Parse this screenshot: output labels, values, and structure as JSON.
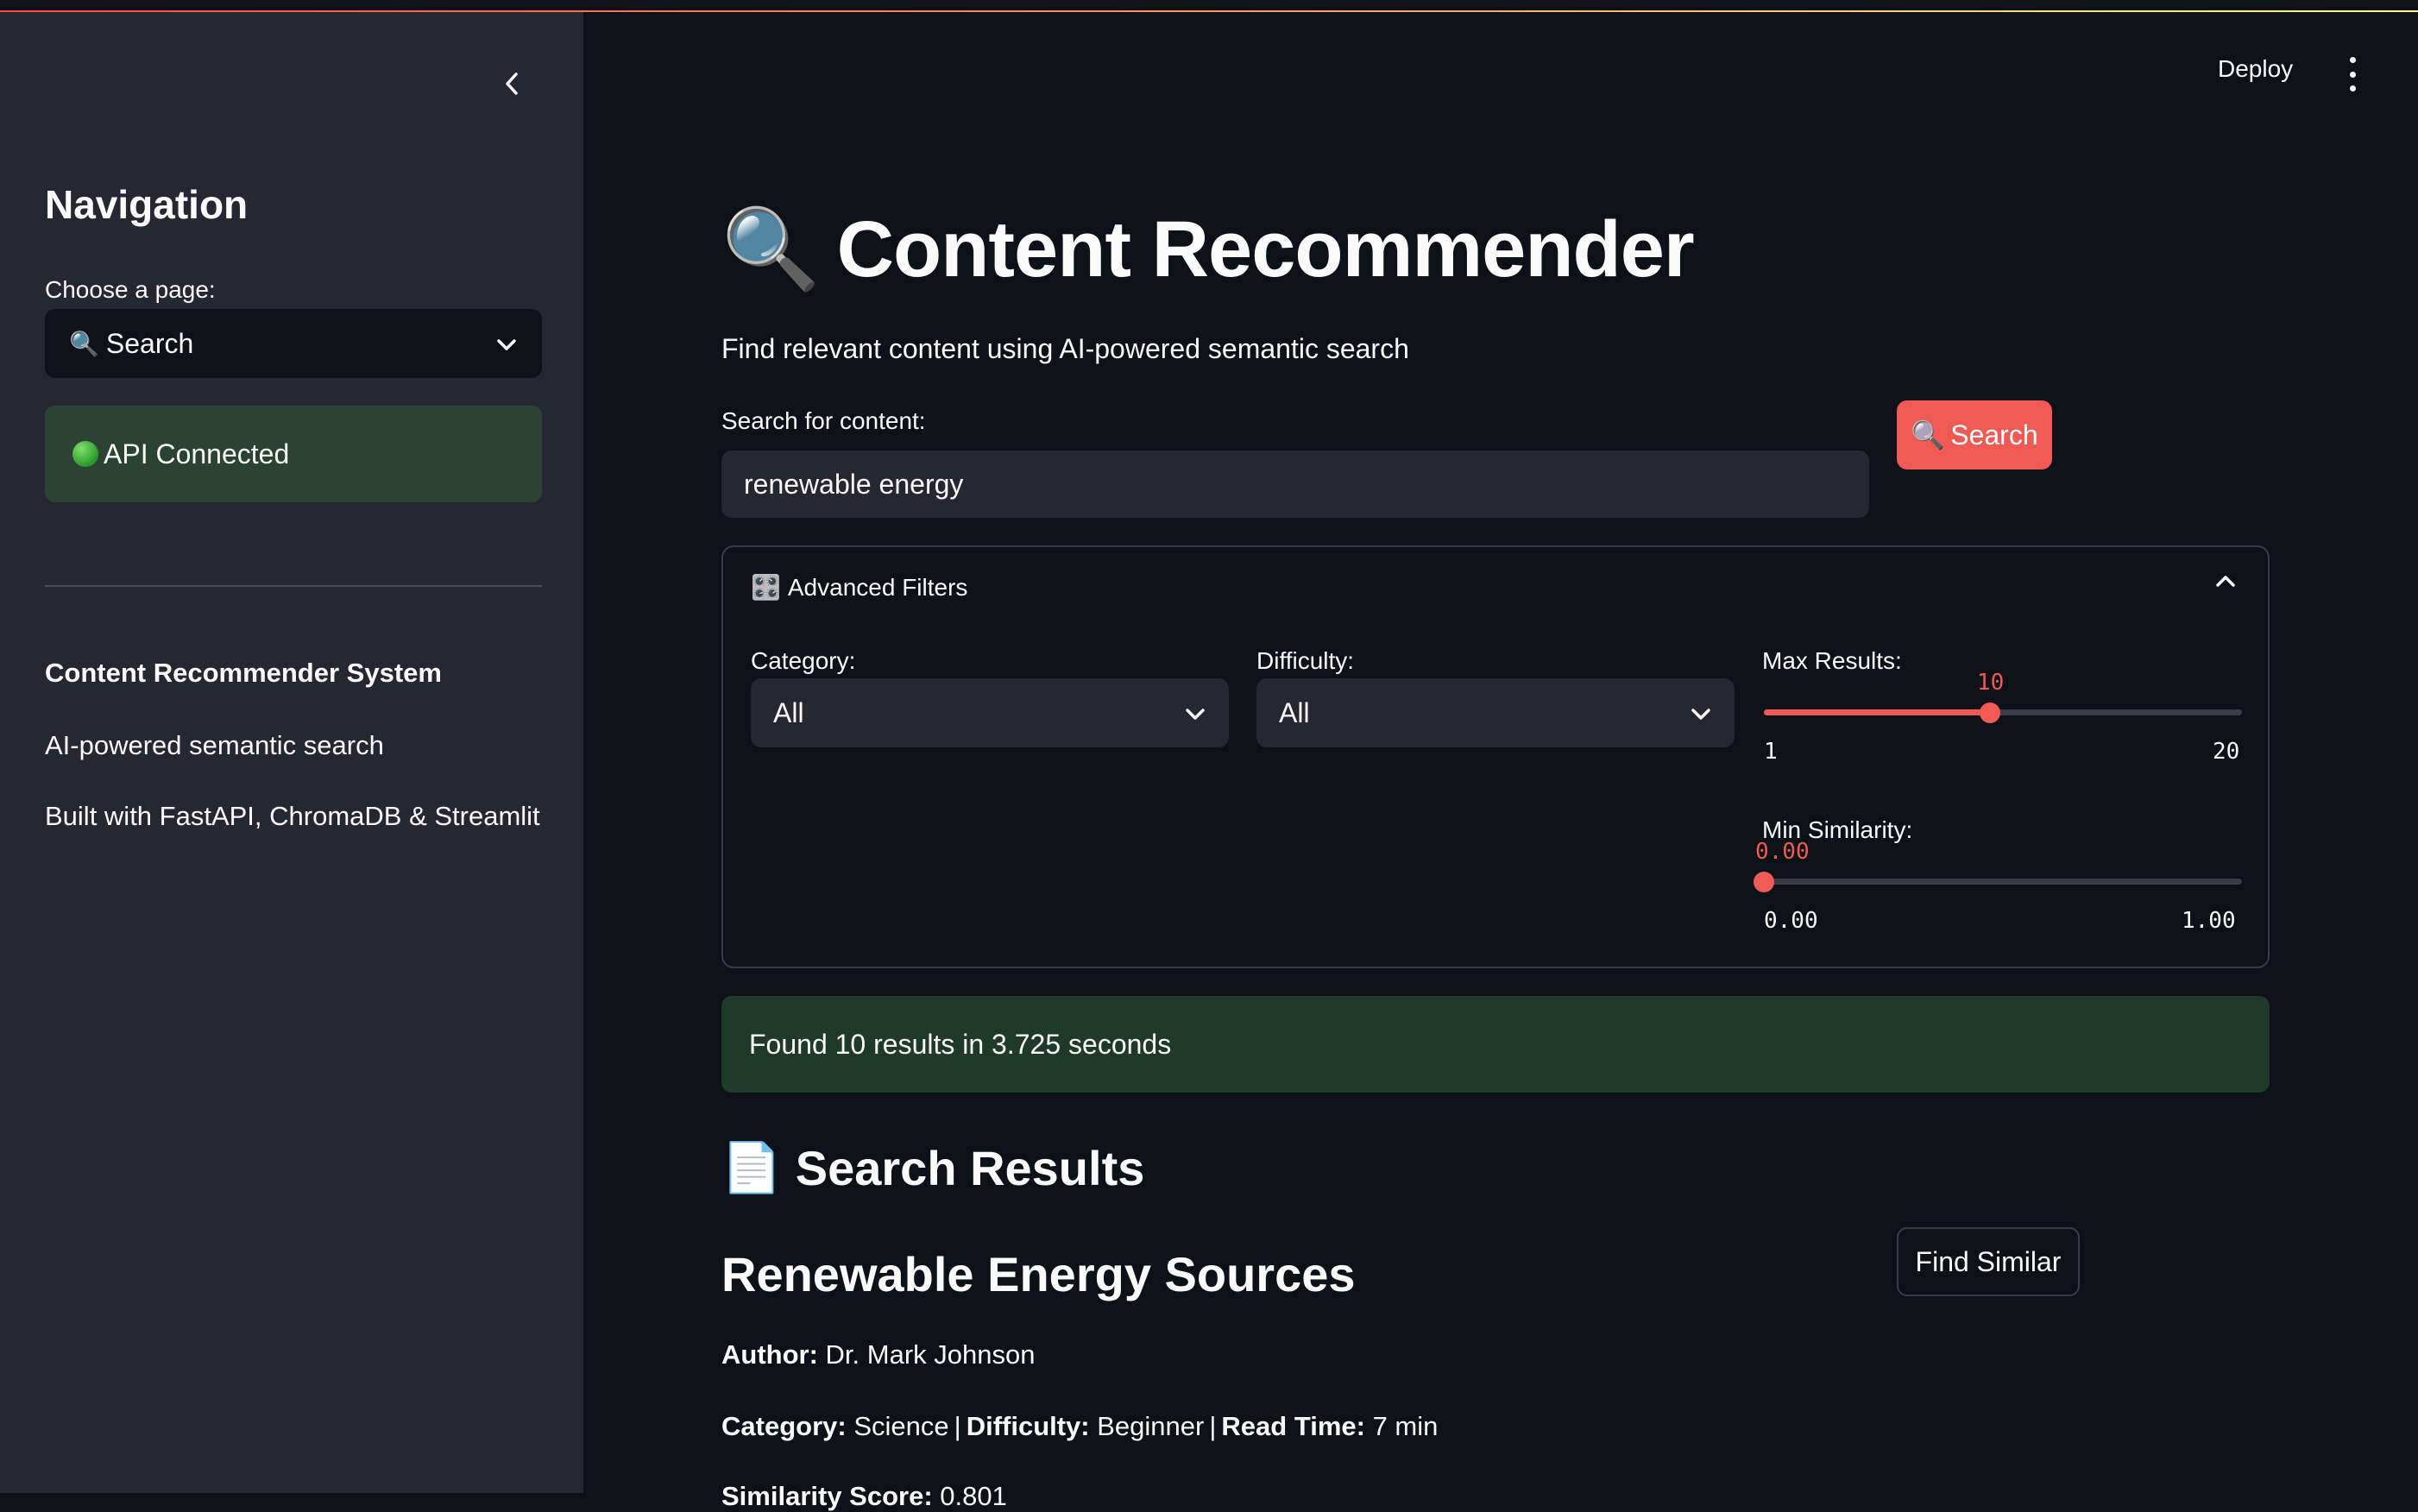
{
  "sidebar": {
    "heading": "Navigation",
    "page_label": "Choose a page:",
    "page_value": "Search",
    "api_status": "API Connected",
    "system_title": "Content Recommender System",
    "line1": "AI-powered semantic search",
    "line2": "Built with FastAPI, ChromaDB & Streamlit"
  },
  "header": {
    "deploy_label": "Deploy"
  },
  "main": {
    "title": "Content Recommender",
    "subtitle": "Find relevant content using AI-powered semantic search",
    "search_label": "Search for content:",
    "search_value": "renewable energy",
    "search_button": "Search",
    "filters": {
      "title": "Advanced Filters",
      "category_label": "Category:",
      "category_value": "All",
      "difficulty_label": "Difficulty:",
      "difficulty_value": "All",
      "max_results": {
        "label": "Max Results:",
        "value": "10",
        "min": "1",
        "max": "20",
        "fraction": 0.4737
      },
      "min_similarity": {
        "label": "Min Similarity:",
        "value": "0.00",
        "min": "0.00",
        "max": "1.00",
        "fraction": 0.0
      }
    },
    "found_message": "Found 10 results in 3.725 seconds",
    "results_heading": "Search Results",
    "result": {
      "title": "Renewable Energy Sources",
      "find_similar": "Find Similar",
      "author_label": "Author:",
      "author": "Dr. Mark Johnson",
      "category_label": "Category:",
      "category": "Science",
      "difficulty_label": "Difficulty:",
      "difficulty": "Beginner",
      "read_time_label": "Read Time:",
      "read_time": "7 min",
      "similarity_label": "Similarity Score:",
      "similarity": "0.801"
    }
  },
  "colors": {
    "accent": "#ef5a55",
    "background": "#0e1117",
    "sidebar": "#262730",
    "success": "#1f3a2b"
  },
  "icons": [
    "chevron-left-icon",
    "chevron-down-icon",
    "magnifier-icon",
    "green-circle-icon",
    "control-panel-icon",
    "chevron-up-icon",
    "document-icon",
    "kebab-menu-icon"
  ]
}
